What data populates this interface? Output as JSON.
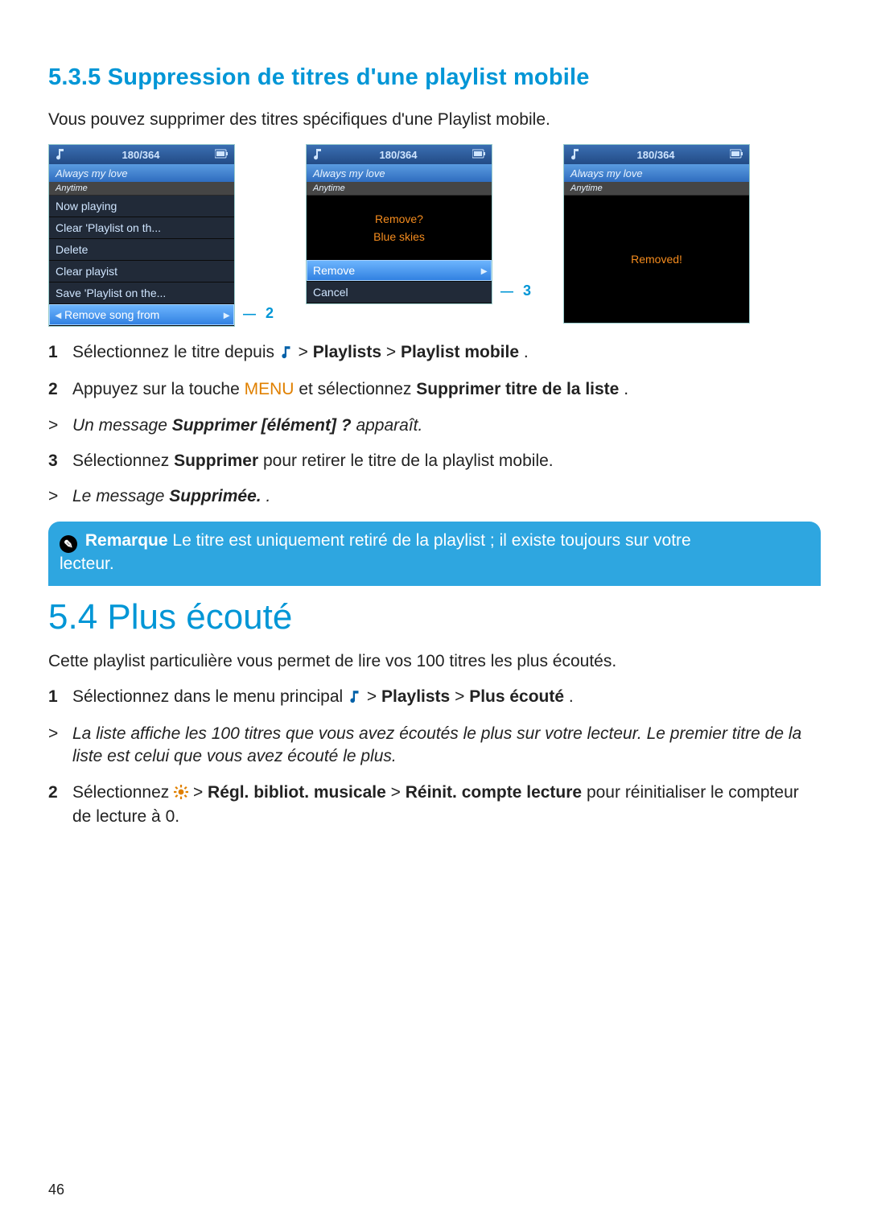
{
  "headings": {
    "h535_prefix": "5.3.5",
    "h535_title": "Suppression de titres d'une playlist mobile",
    "h54_prefix": "5.4",
    "h54_title": "Plus écouté"
  },
  "intro_535": "Vous pouvez supprimer des titres spécifiques d'une Playlist mobile.",
  "intro_54": "Cette playlist particulière vous permet de lire vos 100 titres les plus écoutés.",
  "device": {
    "counter": "180/364",
    "now_title": "Always my love",
    "sub_title": "Anytime"
  },
  "screen1_menu": [
    "Now playing",
    "Clear 'Playlist on th...",
    "Delete",
    "Clear playist",
    "Save 'Playlist on the...",
    "Remove song from"
  ],
  "screen2": {
    "line1": "Remove?",
    "line2": "Blue skies",
    "opt_remove": "Remove",
    "opt_cancel": "Cancel"
  },
  "screen3": {
    "msg": "Removed!"
  },
  "annot": {
    "two": "2",
    "three": "3"
  },
  "steps_535": {
    "s1_pre": "Sélectionnez le titre depuis ",
    "s1_post": " > ",
    "s1_b1": "Playlists",
    "s1_sep": " > ",
    "s1_b2": "Playlist mobile",
    "s1_end": ".",
    "s2_pre": "Appuyez sur la touche ",
    "s2_menu": "MENU",
    "s2_mid": " et sélectionnez ",
    "s2_b": "Supprimer titre de la liste",
    "s2_end": ".",
    "r1_pre": "Un message ",
    "r1_b": "Supprimer [élément] ?",
    "r1_post": " apparaît.",
    "s3_pre": "Sélectionnez ",
    "s3_b": "Supprimer",
    "s3_post": " pour retirer le titre de la playlist mobile.",
    "r2_pre": "Le message ",
    "r2_b": "Supprimée.",
    "r2_post": "."
  },
  "note": {
    "label": "Remarque",
    "text1": " Le titre est uniquement retiré de la playlist ; il existe toujours sur votre ",
    "text2": "lecteur."
  },
  "steps_54": {
    "s1_pre": "Sélectionnez dans le menu principal ",
    "s1_post": " > ",
    "s1_b1": "Playlists",
    "s1_sep": " > ",
    "s1_b2": "Plus écouté",
    "s1_end": ".",
    "r1": "La liste affiche les 100 titres que vous avez écoutés le plus sur votre lecteur. Le premier titre de la liste est celui que vous avez écouté le plus.",
    "s2_pre": "Sélectionnez ",
    "s2_mid": " > ",
    "s2_b1": "Régl. bibliot. musicale",
    "s2_sep": " > ",
    "s2_b2": "Réinit. compte lecture",
    "s2_post": " pour réinitialiser le compteur de lecture à 0."
  },
  "page_num": "46",
  "nums": {
    "n1": "1",
    "n2": "2",
    "n3": "3",
    "arrow": ">"
  }
}
